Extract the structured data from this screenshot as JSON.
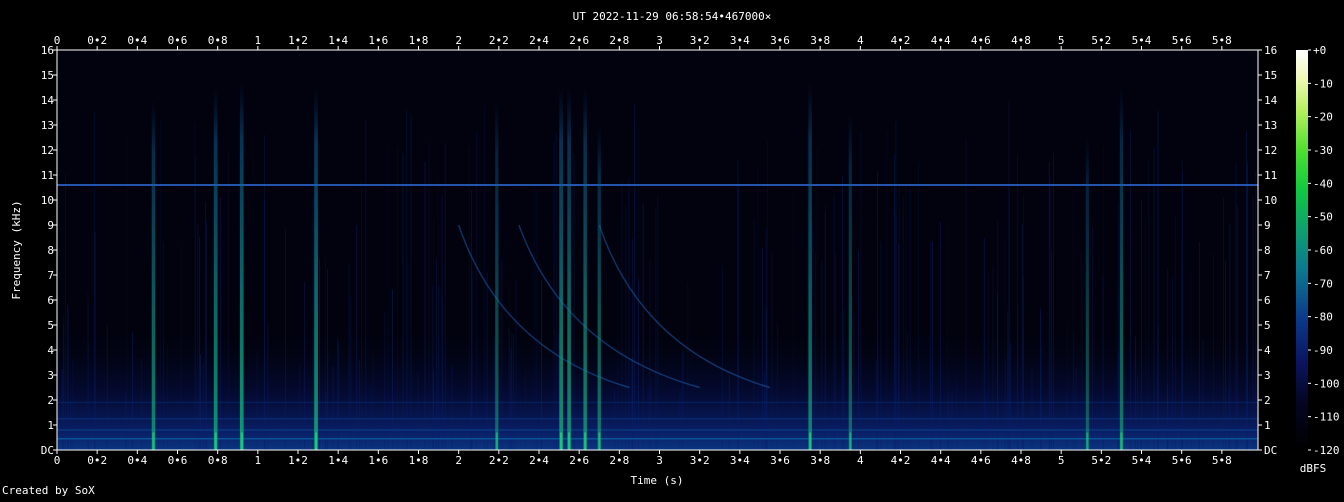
{
  "chart_data": {
    "type": "heatmap",
    "title": "UT 2022-11-29 06:58:54•467000×",
    "xlabel": "Time (s)",
    "ylabel": "Frequency (kHz)",
    "xlim": [
      0,
      5.98
    ],
    "ylim": [
      0,
      16
    ],
    "x_ticks": [
      "0",
      "0•2",
      "0•4",
      "0•6",
      "0•8",
      "1",
      "1•2",
      "1•4",
      "1•6",
      "1•8",
      "2",
      "2•2",
      "2•4",
      "2•6",
      "2•8",
      "3",
      "3•2",
      "3•4",
      "3•6",
      "3•8",
      "4",
      "4•2",
      "4•4",
      "4•6",
      "4•8",
      "5",
      "5•2",
      "5•4",
      "5•6",
      "5•8"
    ],
    "y_ticks": [
      "DC",
      "1",
      "2",
      "3",
      "4",
      "5",
      "6",
      "7",
      "8",
      "9",
      "10",
      "11",
      "12",
      "13",
      "14",
      "15",
      "16"
    ],
    "colorbar": {
      "label": "dBFS",
      "range": [
        -120,
        0
      ],
      "ticks": [
        "+0",
        "-10",
        "-20",
        "-30",
        "-40",
        "-50",
        "-60",
        "-70",
        "-80",
        "-90",
        "-100",
        "-110",
        "-120"
      ]
    },
    "hum_line_khz": 10.6,
    "events": [
      {
        "t": 0.48,
        "f_top": 14.0,
        "db": -75
      },
      {
        "t": 0.79,
        "f_top": 14.5,
        "db": -70
      },
      {
        "t": 0.92,
        "f_top": 14.7,
        "db": -68
      },
      {
        "t": 1.29,
        "f_top": 14.5,
        "db": -68
      },
      {
        "t": 2.19,
        "f_top": 14.0,
        "db": -85
      },
      {
        "t": 2.51,
        "f_top": 14.5,
        "db": -70
      },
      {
        "t": 2.55,
        "f_top": 14.5,
        "db": -72
      },
      {
        "t": 2.63,
        "f_top": 14.5,
        "db": -74
      },
      {
        "t": 2.7,
        "f_top": 13.0,
        "db": -80
      },
      {
        "t": 3.75,
        "f_top": 14.7,
        "db": -75
      },
      {
        "t": 3.95,
        "f_top": 13.5,
        "db": -85
      },
      {
        "t": 5.13,
        "f_top": 12.5,
        "db": -88
      },
      {
        "t": 5.3,
        "f_top": 14.5,
        "db": -80
      }
    ]
  },
  "footer": {
    "credit": "Created by SoX"
  }
}
